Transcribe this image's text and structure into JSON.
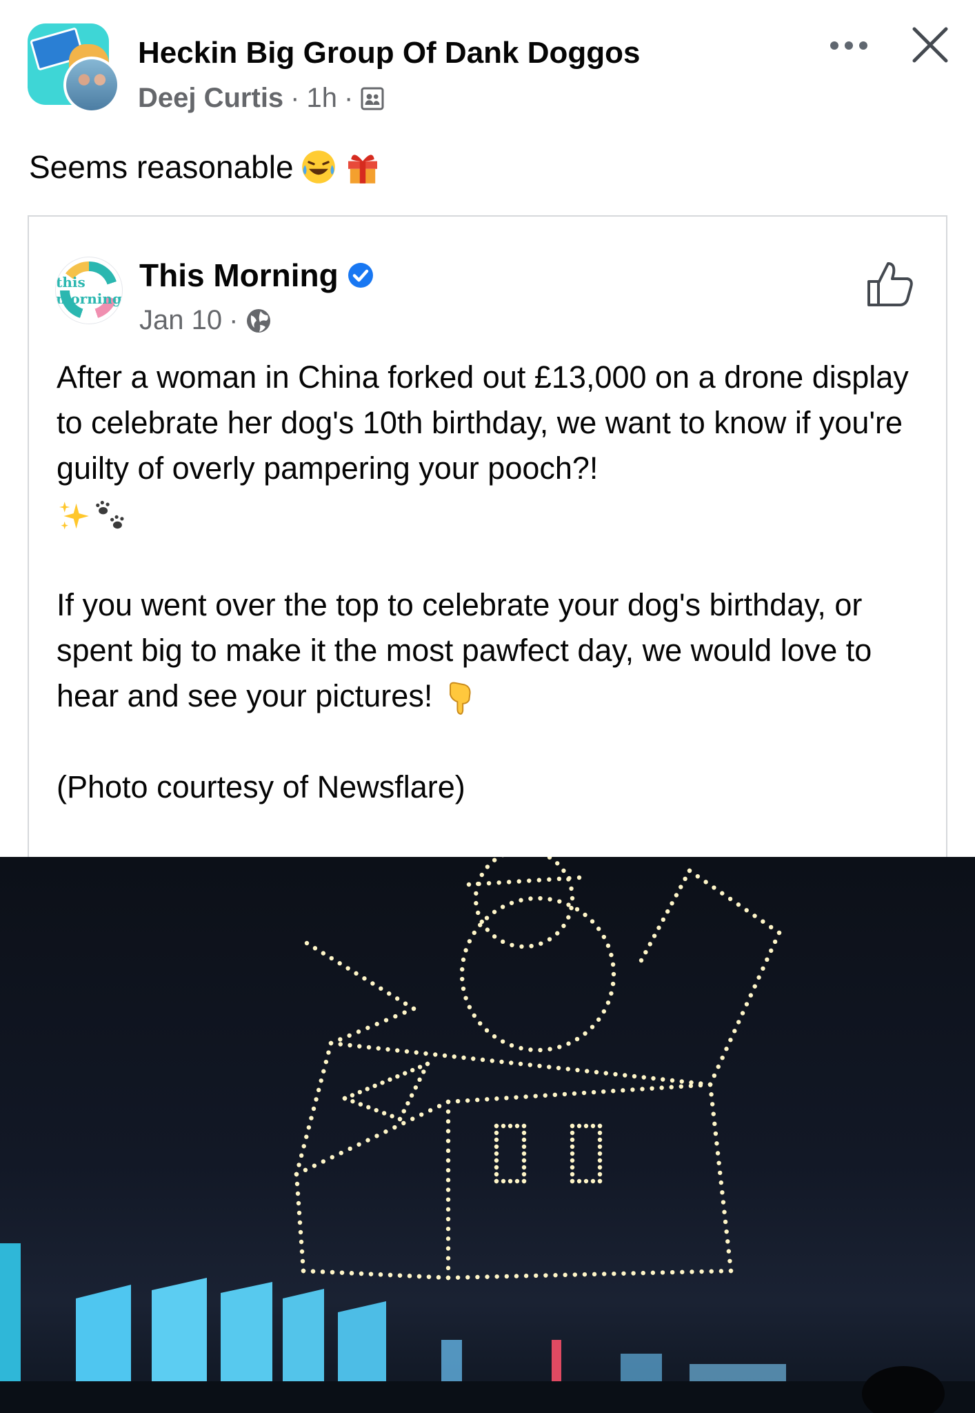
{
  "post": {
    "group_name": "Heckin Big Group Of Dank Doggos",
    "author": "Deej Curtis",
    "separator": "·",
    "time": "1h",
    "audience_icon": "group-members-icon",
    "caption": "Seems reasonable",
    "caption_emojis": [
      "face-with-tears-of-joy",
      "wrapped-gift"
    ]
  },
  "shared_post": {
    "page_name": "This Morning",
    "avatar_text": "this morning",
    "verified": true,
    "date": "Jan 10",
    "separator": "·",
    "privacy_icon": "globe-icon",
    "paragraph1": "After a woman in China forked out £13,000 on a drone display to celebrate her dog's 10th birthday, we want to know if you're guilty of overly pampering your pooch?!",
    "paragraph1_emojis": [
      "sparkles",
      "paw-prints"
    ],
    "paragraph2": "If you went over the top to celebrate your dog's birthday, or spent big to make it the most pawfect day, we would love to hear and see your pictures!",
    "paragraph2_emoji": "backhand-index-pointing-down",
    "paragraph3": "(Photo courtesy of Newsflare)"
  },
  "photo": {
    "description_icon": "drone-light-show-image"
  },
  "colors": {
    "text": "#050505",
    "secondary": "#65676b",
    "verified_blue": "#1877f2",
    "drone_light": "#fff6c8"
  }
}
